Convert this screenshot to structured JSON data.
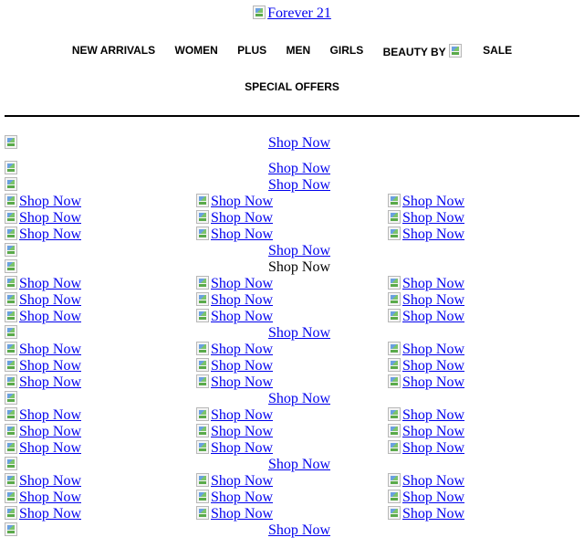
{
  "logo": {
    "alt": "Forever 21"
  },
  "nav": {
    "row1": [
      "NEW ARRIVALS",
      "WOMEN",
      "PLUS",
      "MEN",
      "GIRLS",
      "BEAUTY BY",
      "SALE"
    ],
    "row2": [
      "SPECIAL OFFERS"
    ]
  },
  "content": {
    "shop_now": "Shop Now",
    "rows": [
      {
        "type": "banner",
        "link": true
      },
      {
        "type": "banner",
        "link": true
      },
      {
        "type": "banner",
        "link": true
      },
      {
        "type": "grid"
      },
      {
        "type": "grid"
      },
      {
        "type": "grid"
      },
      {
        "type": "banner",
        "link": true
      },
      {
        "type": "banner",
        "link": false
      },
      {
        "type": "grid"
      },
      {
        "type": "grid"
      },
      {
        "type": "grid"
      },
      {
        "type": "banner",
        "link": true
      },
      {
        "type": "grid"
      },
      {
        "type": "grid"
      },
      {
        "type": "grid"
      },
      {
        "type": "banner",
        "link": true
      },
      {
        "type": "grid"
      },
      {
        "type": "grid"
      },
      {
        "type": "grid"
      },
      {
        "type": "banner",
        "link": true
      },
      {
        "type": "grid"
      },
      {
        "type": "grid"
      },
      {
        "type": "grid"
      },
      {
        "type": "banner",
        "link": true
      }
    ]
  }
}
